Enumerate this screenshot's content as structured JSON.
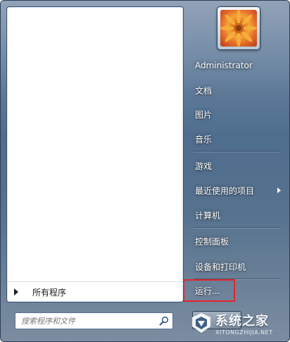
{
  "left_pane": {
    "all_programs_label": "所有程序",
    "search_placeholder": "搜索程序和文件"
  },
  "right_menu": {
    "items": [
      {
        "label": "Administrator"
      },
      {
        "label": "文档"
      },
      {
        "label": "图片"
      },
      {
        "label": "音乐"
      },
      {
        "label": "游戏"
      },
      {
        "label": "最近使用的项目"
      },
      {
        "label": "计算机"
      },
      {
        "label": "控制面板"
      },
      {
        "label": "设备和打印机"
      },
      {
        "label": "运行..."
      }
    ]
  },
  "watermark": {
    "title": "系统之家",
    "url": "XITONGZHIJIA.NET"
  },
  "colors": {
    "highlight_box": "#e3262c",
    "menu_text": "#ffffff"
  }
}
